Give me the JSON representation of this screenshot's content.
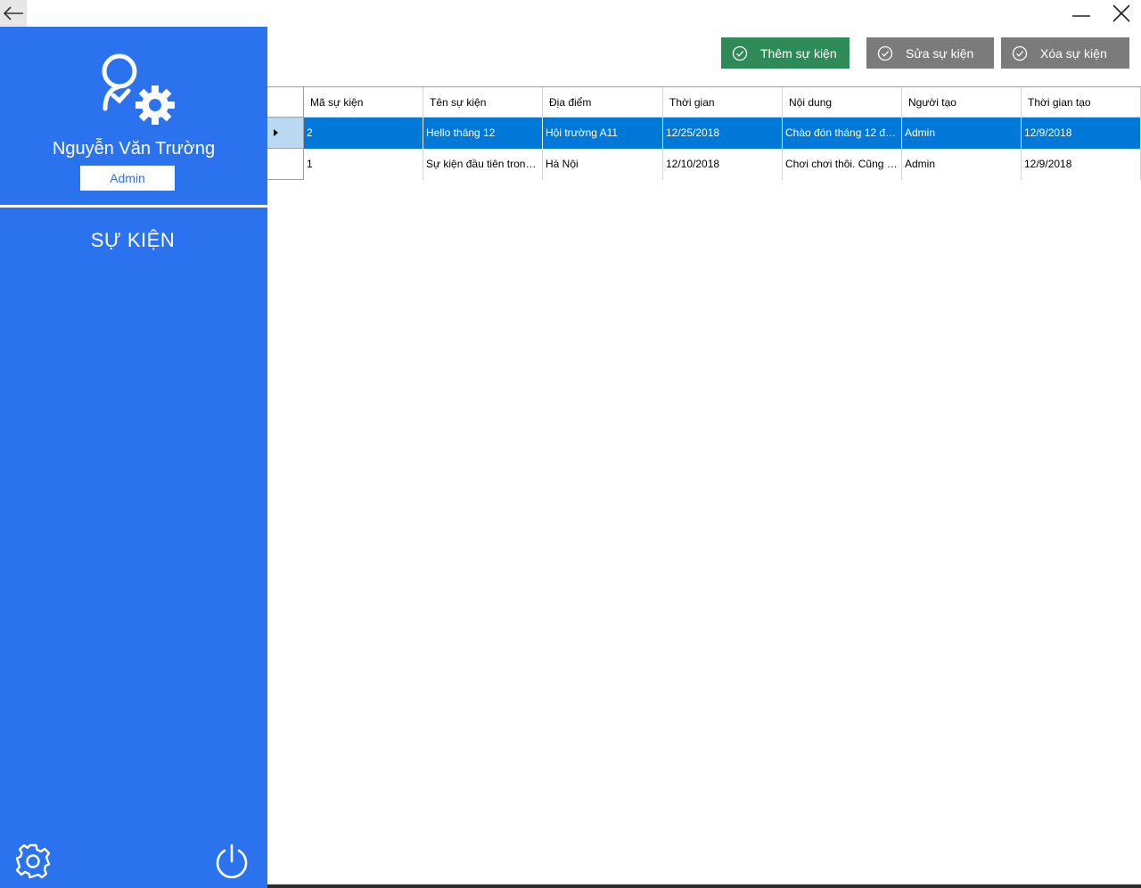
{
  "window": {
    "back_icon": "arrow-left-icon",
    "minimize_icon": "minimize-icon",
    "close_icon": "close-icon"
  },
  "sidebar": {
    "user_name": "Nguyễn Văn Trường",
    "role": "Admin",
    "menu": [
      {
        "label": "SỰ KIỆN"
      }
    ],
    "avatar_icon": "user-settings-icon",
    "settings_icon": "gear-icon",
    "power_icon": "power-icon",
    "bg_color": "#2b72ef"
  },
  "toolbar": {
    "add_label": "Thêm sự kiện",
    "edit_label": "Sửa sự kiện",
    "delete_label": "Xóa sự kiện",
    "add_color": "#2e8b57",
    "disabled_color": "#7b7b7b"
  },
  "table": {
    "columns": [
      "Mã sự kiện",
      "Tên sự kiện",
      "Địa điểm",
      "Thời gian",
      "Nội dung",
      "Người tạo",
      "Thời gian tạo"
    ],
    "rows": [
      [
        "2",
        "Hello tháng 12",
        "Hội trường A11",
        "12/25/2018",
        "Chào đón tháng 12 đến ...",
        "Admin",
        "12/9/2018"
      ],
      [
        "1",
        "Sự kiện đầu tiên trong th...",
        "Hà Nội",
        "12/10/2018",
        "Chơi chơi thôi. Cũng chẳ...",
        "Admin",
        "12/9/2018"
      ]
    ],
    "selected_color": "#0078d7"
  }
}
